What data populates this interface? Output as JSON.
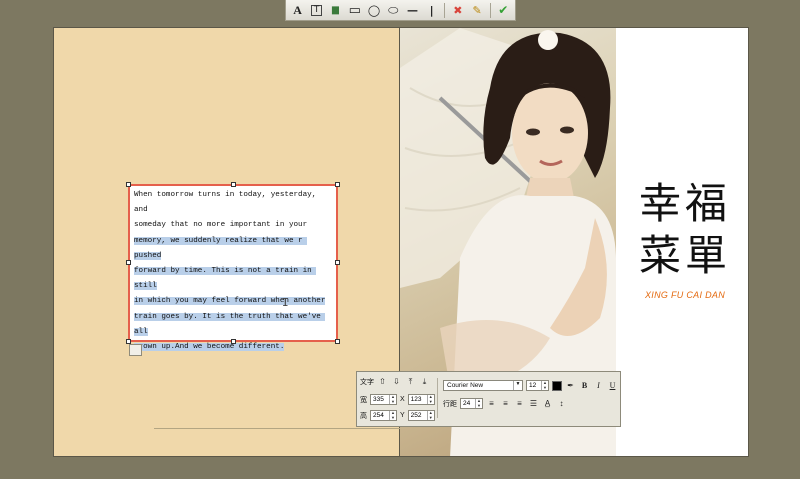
{
  "toolbar": {
    "items": [
      {
        "name": "text-tool",
        "glyph": "A"
      },
      {
        "name": "textbox-tool",
        "glyph": "T"
      },
      {
        "name": "image-tool",
        "glyph": "▆"
      },
      {
        "name": "rectangle-tool",
        "glyph": "▭"
      },
      {
        "name": "circle-tool",
        "glyph": "◯"
      },
      {
        "name": "ellipse-tool",
        "glyph": "⬭"
      },
      {
        "name": "horizontal-line-tool",
        "glyph": "—"
      },
      {
        "name": "vertical-line-tool",
        "glyph": "|"
      },
      {
        "name": "delete-tool",
        "glyph": "✖"
      },
      {
        "name": "edit-tool",
        "glyph": "✎"
      },
      {
        "name": "confirm-tool",
        "glyph": "✔"
      }
    ],
    "colors": {
      "delete": "#d9443b",
      "confirm": "#35a135"
    }
  },
  "spread": {
    "left_page_color": "#f0d8aa",
    "title_line1": "幸福",
    "title_line2": "菜單",
    "subtitle": "XING FU CAI DAN",
    "subtitle_color": "#e46a10"
  },
  "text_frame": {
    "lines": [
      {
        "text": "When tomorrow turns in today, yesterday, and",
        "selected": false
      },
      {
        "text": "someday that no more important in your",
        "selected": false
      },
      {
        "text": "memory, we suddenly realize that we r pushed",
        "selected": true
      },
      {
        "text": "forward by time. This is not a train in still",
        "selected": true
      },
      {
        "text": "in which you may feel forward when another",
        "selected": true
      },
      {
        "text": "train goes by. It is the truth that we've all",
        "selected": true
      },
      {
        "text": "grown up.And we become different.",
        "selected": true
      }
    ],
    "border_color": "#e5604c",
    "selection_color": "#b9cfe9"
  },
  "props": {
    "text_label": "文字",
    "width_label": "宽",
    "height_label": "高",
    "x_label": "X",
    "y_label": "Y",
    "width": "335",
    "height": "254",
    "x": "123",
    "y": "252",
    "font": "Courier New",
    "font_size": "12",
    "line_spacing_label": "行距",
    "line_spacing": "24",
    "bold": "B",
    "italic": "I",
    "underline": "U",
    "text_color": "#000000"
  }
}
